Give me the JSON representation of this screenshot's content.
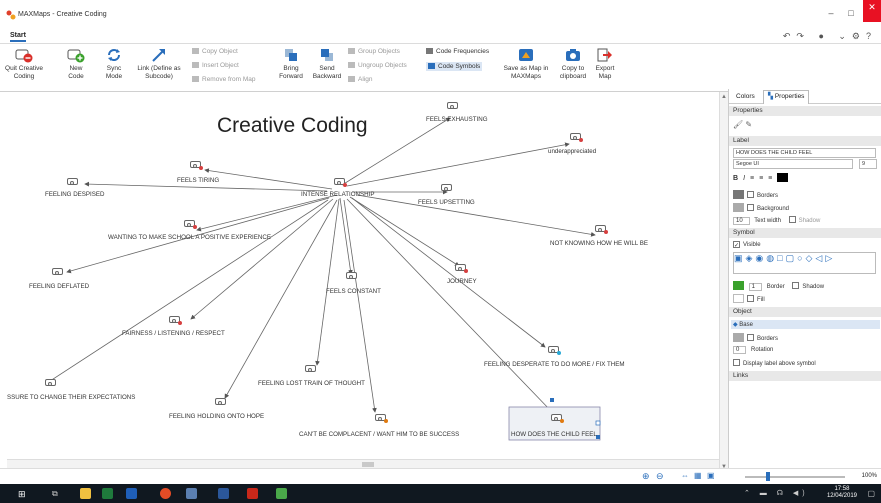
{
  "window": {
    "title": "MAXMaps - Creative Coding"
  },
  "tabs": {
    "start": "Start"
  },
  "ribbon": {
    "quit": "Quit Creative\nCoding",
    "new_code": "New\nCode",
    "sync": "Sync\nMode",
    "link": "Link (Define as\nSubcode)",
    "copy_object": "Copy Object",
    "insert_object": "Insert Object",
    "remove_from_map": "Remove from Map",
    "bring_forward": "Bring\nForward",
    "send_backward": "Send\nBackward",
    "group_objects": "Group Objects",
    "ungroup_objects": "Ungroup Objects",
    "align": "Align",
    "code_frequencies": "Code Frequencies",
    "code_symbols": "Code Symbols",
    "save_as_map": "Save as Map in\nMAXMaps",
    "copy_to_clipboard": "Copy to\nclipboard",
    "export_map": "Export\nMap"
  },
  "map": {
    "title": "Creative Coding",
    "center": "INTENSE RELATIONSHIP",
    "nodes": [
      {
        "label": "FEELS EXHAUSTING",
        "dot": "#d64040"
      },
      {
        "label": "underappreciated",
        "dot": "#d64040"
      },
      {
        "label": "FEELS TIRING",
        "dot": "#d64040"
      },
      {
        "label": "FEELING DESPISED",
        "dot": ""
      },
      {
        "label": "FEELS UPSETTING",
        "dot": ""
      },
      {
        "label": "WANTING TO MAKE SCHOOL A POSITIVE EXPERIENCE",
        "dot": "#d64040"
      },
      {
        "label": "NOT KNOWING HOW HE WILL BE",
        "dot": "#d64040"
      },
      {
        "label": "FEELING DEFLATED",
        "dot": ""
      },
      {
        "label": "FEELS CONSTANT",
        "dot": ""
      },
      {
        "label": "JOURNEY",
        "dot": "#d64040"
      },
      {
        "label": "FAIRNESS / LISTENING / RESPECT",
        "dot": "#d64040"
      },
      {
        "label": "FEELING DESPERATE TO DO MORE / FIX THEM",
        "dot": "#2aa9d6"
      },
      {
        "label": "FEELING LOST TRAIN OF THOUGHT",
        "dot": ""
      },
      {
        "label": "SSURE TO CHANGE THEIR EXPECTATIONS",
        "dot": ""
      },
      {
        "label": "FEELING HOLDING ONTO HOPE",
        "dot": ""
      },
      {
        "label": "CAN'T BE COMPLACENT / WANT HIM TO BE SUCCESS",
        "dot": "#e07a10"
      },
      {
        "label": "HOW DOES THE CHILD FEEL",
        "dot": "#e07a10"
      }
    ]
  },
  "panel": {
    "tab_colors": "Colors",
    "tab_properties": "Properties",
    "section_properties": "Properties",
    "section_label": "Label",
    "label_value": "HOW DOES THE CHILD FEEL",
    "font": "Segoe UI",
    "font_size": "9",
    "borders": "Borders",
    "background": "Background",
    "text_width_value": "10",
    "text_width": "Text width",
    "shadow": "Shadow",
    "section_symbol": "Symbol",
    "visible": "Visible",
    "symbol_border_value": "1",
    "symbol_border": "Border",
    "symbol_shadow": "Shadow",
    "fill": "Fill",
    "section_object": "Object",
    "object_base": "Base",
    "object_borders": "Borders",
    "rotation_value": "0",
    "rotation": "Rotation",
    "display_label": "Display label above symbol",
    "section_links": "Links"
  },
  "status": {
    "zoom": "100%"
  },
  "clock": {
    "time": "17:58",
    "date": "12/04/2019"
  },
  "colors": {
    "accent": "#2a6ebb",
    "close": "#e81123",
    "symbol_green": "#3aa12c",
    "taskbar": "#101820"
  }
}
